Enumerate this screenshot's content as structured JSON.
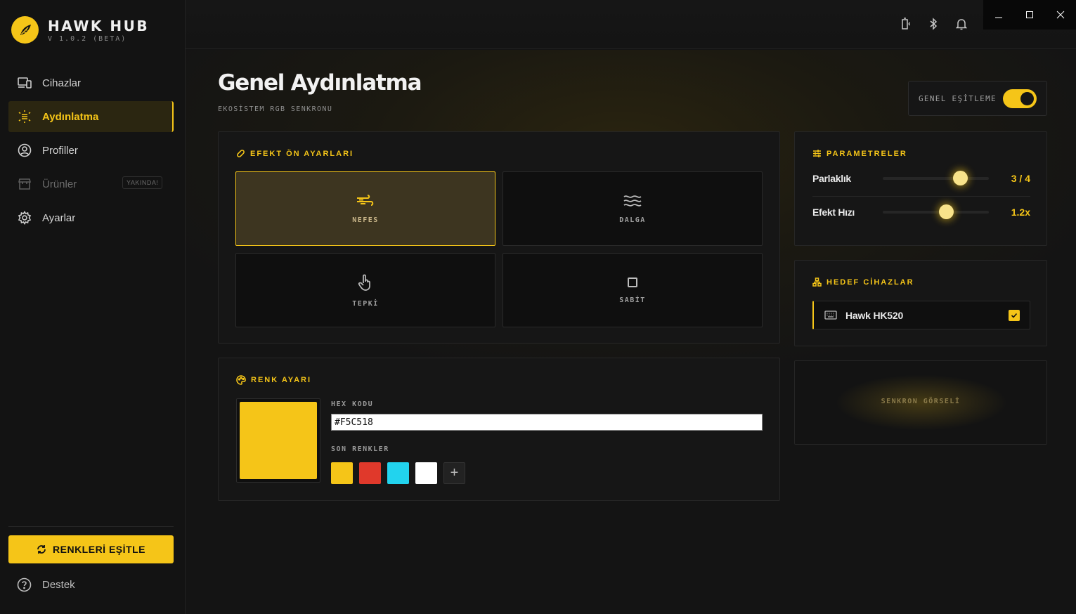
{
  "app": {
    "title": "HAWK HUB",
    "version": "V 1.0.2 (BETA)"
  },
  "colors": {
    "accent": "#f5c518",
    "background": "#131313",
    "panel": "#161616"
  },
  "sidebar": {
    "items": [
      {
        "label": "Cihazlar",
        "icon": "devices-icon",
        "active": false
      },
      {
        "label": "Aydınlatma",
        "icon": "lighting-icon",
        "active": true
      },
      {
        "label": "Profiller",
        "icon": "profile-icon",
        "active": false
      },
      {
        "label": "Ürünler",
        "icon": "store-icon",
        "disabled": true,
        "badge": "YAKINDA!"
      },
      {
        "label": "Ayarlar",
        "icon": "gear-icon",
        "active": false
      }
    ],
    "sync_button": "RENKLERİ EŞİTLE",
    "support": "Destek"
  },
  "topbar": {
    "icons": [
      "device-battery-icon",
      "bluetooth-icon",
      "bell-icon"
    ]
  },
  "page": {
    "title": "Genel Aydınlatma",
    "subtitle": "EKOSİSTEM RGB SENKRONU"
  },
  "global_sync": {
    "label": "GENEL EŞİTLEME",
    "enabled": true
  },
  "effects": {
    "title": "EFEKT ÖN AYARLARI",
    "items": [
      {
        "label": "NEFES",
        "icon": "wind-icon",
        "selected": true
      },
      {
        "label": "DALGA",
        "icon": "waves-icon",
        "selected": false
      },
      {
        "label": "TEPKİ",
        "icon": "touch-icon",
        "selected": false
      },
      {
        "label": "SABİT",
        "icon": "square-icon",
        "selected": false
      }
    ]
  },
  "color": {
    "title": "RENK AYARI",
    "hex_label": "HEX KODU",
    "hex_value": "#F5C518",
    "recent_label": "SON RENKLER",
    "recent": [
      "#F5C518",
      "#E0392B",
      "#22D3EE",
      "#FFFFFF"
    ],
    "add_label": "+"
  },
  "params": {
    "title": "PARAMETRELER",
    "items": [
      {
        "label": "Parlaklık",
        "value": "3 / 4",
        "level": 0.73
      },
      {
        "label": "Efekt Hızı",
        "value": "1.2x",
        "level": 0.6
      }
    ]
  },
  "targets": {
    "title": "HEDEF CİHAZLAR",
    "devices": [
      {
        "name": "Hawk HK520",
        "checked": true
      }
    ]
  },
  "sync_visual": {
    "label": "SENKRON GÖRSELİ"
  }
}
